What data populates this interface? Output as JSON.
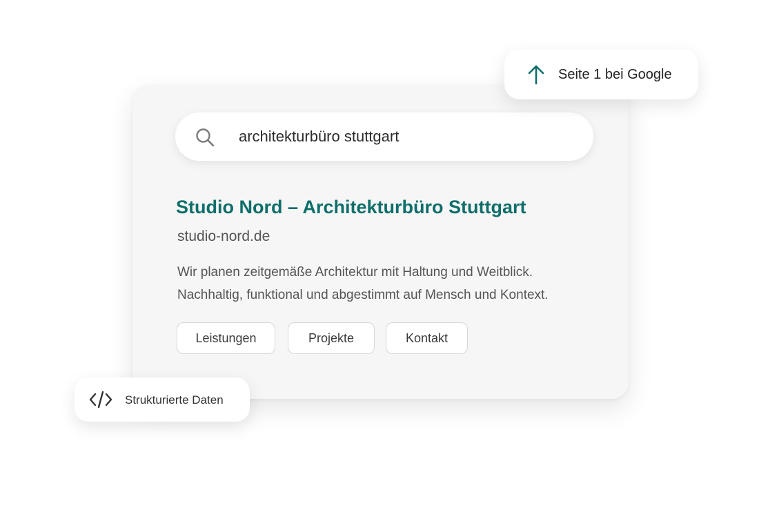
{
  "search": {
    "query": "architekturbüro stuttgart",
    "icon": "search-icon"
  },
  "result": {
    "title": "Studio Nord – Architekturbüro Stuttgart",
    "url": "studio-nord.de",
    "description_line1": "Wir planen zeitgemäße Architektur mit Haltung und Weitblick.",
    "description_line2": "Nachhaltig, funktional und abgestimmt auf Mensch und Kontext.",
    "sitelinks": [
      "Leistungen",
      "Projekte",
      "Kontakt"
    ]
  },
  "badges": {
    "ranking": {
      "label": "Seite 1 bei Google",
      "icon": "arrow-up-icon"
    },
    "structured_data": {
      "label": "Strukturierte Daten",
      "icon": "code-icon"
    }
  },
  "colors": {
    "accent": "#0e6e6a",
    "card_background": "#f6f6f6",
    "page_background": "#ffffff"
  }
}
